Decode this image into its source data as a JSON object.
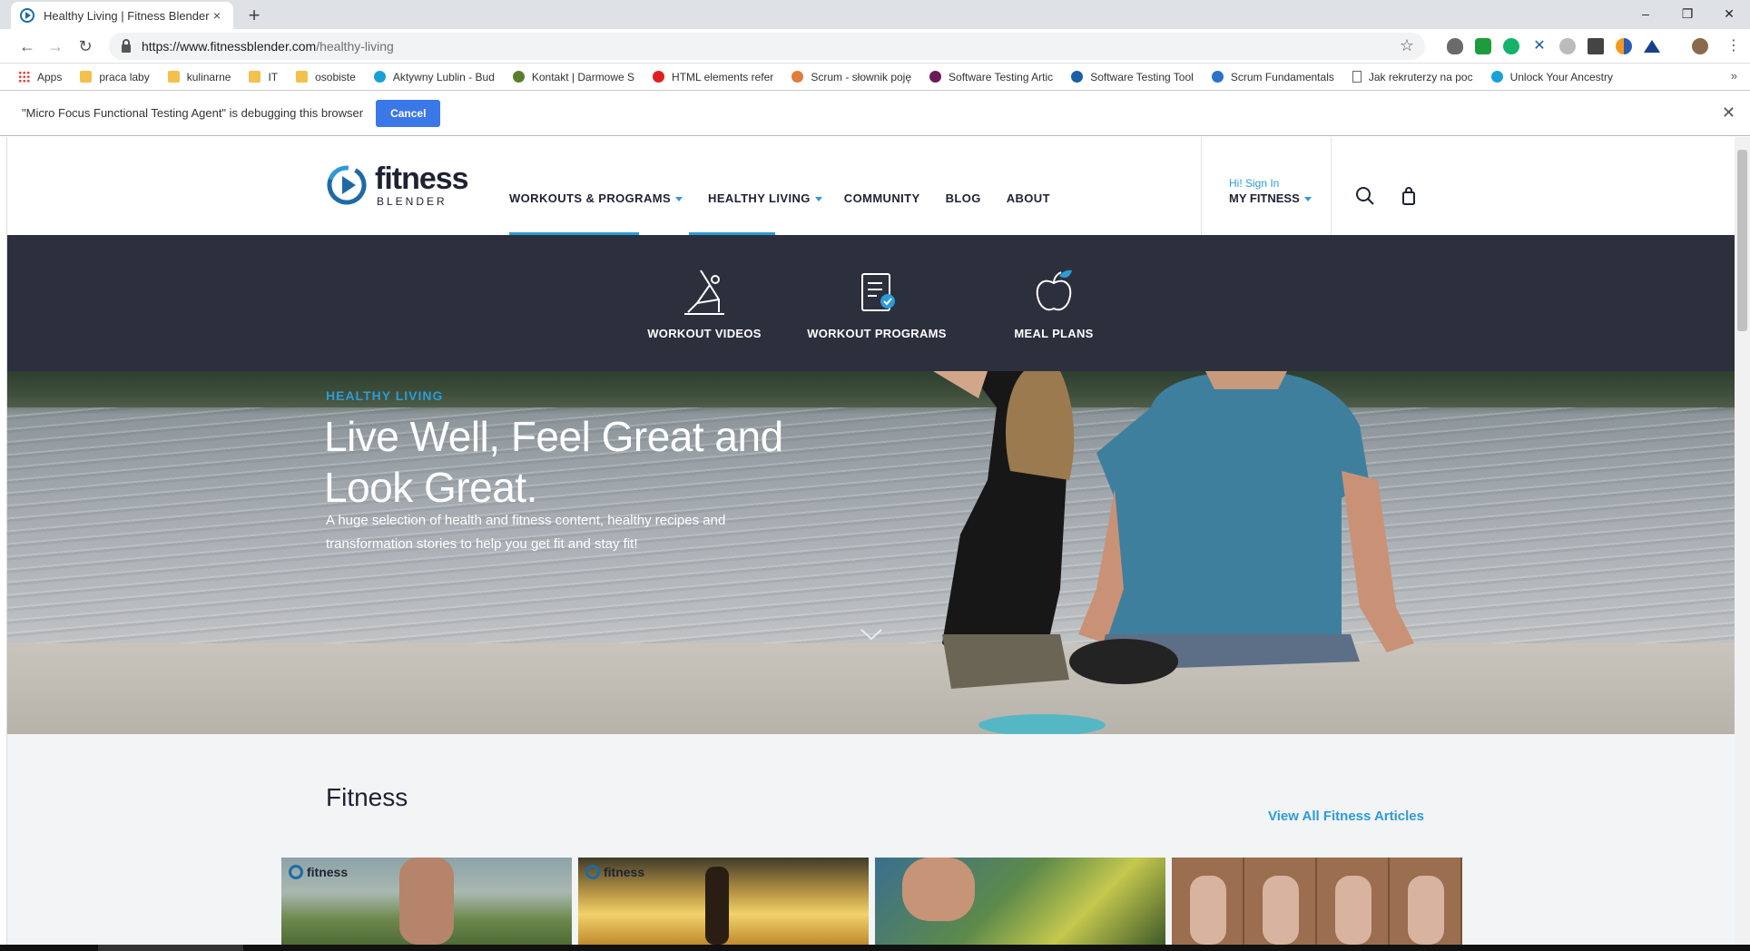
{
  "browser": {
    "tab_title": "Healthy Living | Fitness Blender",
    "tab_close": "×",
    "new_tab": "+",
    "url_host": "https://www.fitnessblender.com",
    "url_path": "/healthy-living",
    "win_min": "–",
    "win_restore": "❐",
    "win_close": "✕",
    "bookmarks": [
      {
        "label": "Apps",
        "icon": "apps-icon"
      },
      {
        "label": "praca laby",
        "icon": "folder-icon"
      },
      {
        "label": "kulinarne",
        "icon": "folder-icon"
      },
      {
        "label": "IT",
        "icon": "folder-icon"
      },
      {
        "label": "osobiste",
        "icon": "folder-icon"
      },
      {
        "label": "Aktywny Lublin - Bud",
        "icon": "site-icon"
      },
      {
        "label": "Kontakt | Darmowe S",
        "icon": "site-icon"
      },
      {
        "label": "HTML elements refer",
        "icon": "site-icon"
      },
      {
        "label": "Scrum - słownik poję",
        "icon": "site-icon"
      },
      {
        "label": "Software Testing Artic",
        "icon": "site-icon"
      },
      {
        "label": "Software Testing Tool",
        "icon": "site-icon"
      },
      {
        "label": "Scrum Fundamentals",
        "icon": "site-icon"
      },
      {
        "label": "Jak rekruterzy na poc",
        "icon": "page-icon"
      },
      {
        "label": "Unlock Your Ancestry",
        "icon": "site-icon"
      }
    ],
    "bookmarks_more": "»",
    "infobar_text": "\"Micro Focus Functional Testing Agent\" is debugging this browser",
    "infobar_cancel": "Cancel",
    "infobar_close": "✕"
  },
  "site": {
    "logo_word": "fitness",
    "logo_sub": "BLENDER",
    "nav": [
      {
        "label": "WORKOUTS & PROGRAMS",
        "caret": true
      },
      {
        "label": "HEALTHY LIVING",
        "caret": true
      },
      {
        "label": "COMMUNITY",
        "caret": false
      },
      {
        "label": "BLOG",
        "caret": false
      },
      {
        "label": "ABOUT",
        "caret": false
      }
    ],
    "signin": "Hi! Sign In",
    "myfitness": "MY FITNESS",
    "accent": "#2d9bd6",
    "dark": "#2c303d"
  },
  "submenu": {
    "items": [
      {
        "label": "WORKOUT VIDEOS",
        "icon": "yoga-pose-icon"
      },
      {
        "label": "WORKOUT PROGRAMS",
        "icon": "checklist-icon"
      },
      {
        "label": "MEAL PLANS",
        "icon": "apple-icon"
      }
    ]
  },
  "hero": {
    "kicker": "HEALTHY LIVING",
    "title": "Live Well, Feel Great and Look Great.",
    "subtitle": "A huge selection of health and fitness content, healthy recipes and transformation stories to help you get fit and stay fit!"
  },
  "fitness": {
    "title": "Fitness",
    "view_all": "View All Fitness Articles",
    "thumb_brand": "fitness"
  }
}
